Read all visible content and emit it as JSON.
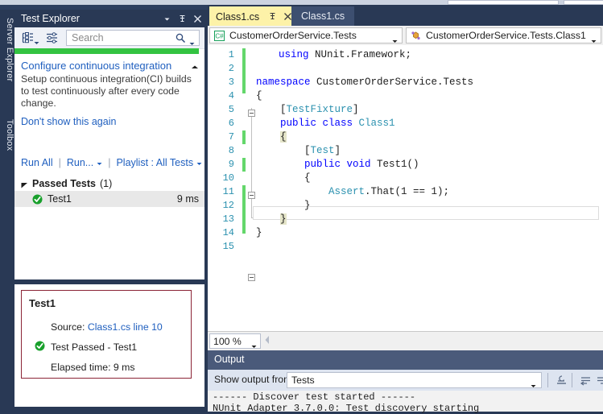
{
  "vertical_dock": {
    "tabs": [
      {
        "label": "Server Explorer"
      },
      {
        "label": "Toolbox"
      }
    ]
  },
  "test_explorer": {
    "title": "Test Explorer",
    "window_buttons": [
      {
        "name": "dropdown",
        "icon": "chevron-down-icon"
      },
      {
        "name": "pin",
        "icon": "pin-icon"
      },
      {
        "name": "close",
        "icon": "close-icon"
      }
    ],
    "toolbar": {
      "group_by_icon": "group-by-icon",
      "group_by_caret": "chevron-down-icon",
      "sort_icon": "sort-icon",
      "search_placeholder": "Search",
      "search_value": "",
      "search_icon": "magnifier-icon",
      "search_caret": "chevron-down-icon"
    },
    "progress_color": "#33c341",
    "ci_banner": {
      "link": "Configure continuous integration",
      "description": "Setup continuous integration(CI) builds to test continuously after every code change.",
      "dismiss": "Don't show this again",
      "collapse_icon": "chevron-up-icon"
    },
    "actions": {
      "run_all": "Run All",
      "run": "Run...",
      "playlist": "Playlist : All Tests"
    },
    "groups": [
      {
        "name": "Passed Tests",
        "count": "(1)",
        "expanded": true,
        "tests": [
          {
            "name": "Test1",
            "duration": "9 ms",
            "status": "passed",
            "status_icon": "check-circle-icon"
          }
        ]
      }
    ],
    "detail": {
      "title": "Test1",
      "source_label": "Source:",
      "source_link": "Class1.cs line 10",
      "result_icon": "check-circle-icon",
      "result": "Test Passed - Test1",
      "elapsed": "Elapsed time: 9 ms",
      "border_color": "#8b2436"
    }
  },
  "editor": {
    "tabs": [
      {
        "label": "Class1.cs",
        "active": true,
        "pin_icon": "pin-icon",
        "close_icon": "close-icon"
      },
      {
        "label": "Class1.cs",
        "active": false
      }
    ],
    "navbar": {
      "left": {
        "icon": "csharp-project-icon",
        "text": "CustomerOrderService.Tests",
        "caret": "chevron-down-icon"
      },
      "right": {
        "icon": "class-icon",
        "text": "CustomerOrderService.Tests.Class1",
        "caret": "chevron-down-icon"
      }
    },
    "lines": [
      {
        "n": "1",
        "text": "    using NUnit.Framework;"
      },
      {
        "n": "2",
        "text": ""
      },
      {
        "n": "3",
        "text": "namespace CustomerOrderService.Tests"
      },
      {
        "n": "4",
        "text": " {"
      },
      {
        "n": "5",
        "text": "     [TestFixture]"
      },
      {
        "n": "6",
        "text": "     public class Class1"
      },
      {
        "n": "7",
        "text": "     {"
      },
      {
        "n": "8",
        "text": "         [Test]"
      },
      {
        "n": "9",
        "text": "         public void Test1()"
      },
      {
        "n": "10",
        "text": "         {"
      },
      {
        "n": "11",
        "text": "             Assert.That(1 == 1);"
      },
      {
        "n": "12",
        "text": "         }"
      },
      {
        "n": "13",
        "text": "     }"
      },
      {
        "n": "14",
        "text": " }"
      },
      {
        "n": "15",
        "text": ""
      }
    ],
    "zoom": {
      "value": "100 %",
      "caret": "chevron-down-icon"
    }
  },
  "output": {
    "title": "Output",
    "show_from_label": "Show output from:",
    "show_from_value": "Tests",
    "show_from_caret": "chevron-down-icon",
    "buttons": [
      {
        "name": "clear-all",
        "icon": "clear-all-icon"
      },
      {
        "name": "toggle-word-wrap",
        "icon": "word-wrap-icon"
      },
      {
        "name": "toggle-autoscroll",
        "icon": "autoscroll-icon"
      }
    ],
    "lines": [
      "------ Discover test started ------",
      "NUnit Adapter 3.7.0.0: Test discovery starting"
    ]
  }
}
